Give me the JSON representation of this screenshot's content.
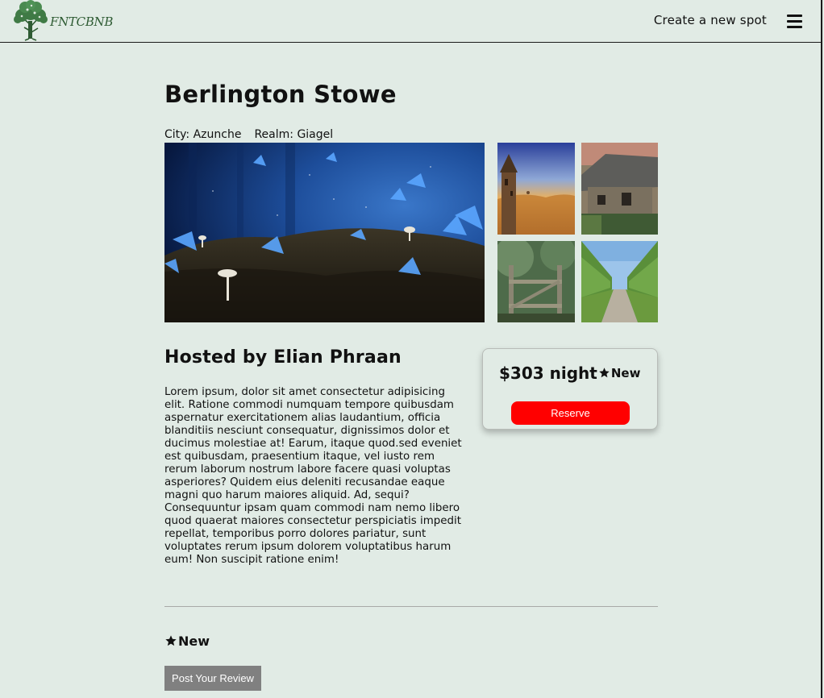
{
  "header": {
    "logo_text": "FNTCBNB",
    "create_link": "Create a new spot",
    "menu_icon": "hamburger-menu-icon"
  },
  "spot": {
    "name": "Berlington Stowe",
    "city_label": "City: Azunche",
    "realm_label": "Realm: Giagel",
    "host_heading": "Hosted by Elian Phraan",
    "description": "Lorem ipsum, dolor sit amet consectetur adipisicing elit. Ratione commodi numquam tempore quibusdam aspernatur exercitationem alias laudantium, officia blanditiis nesciunt consequatur, dignissimos dolor et ducimus molestiae at! Earum, itaque quod.sed eveniet est quibusdam, praesentium itaque, vel iusto rem rerum laborum nostrum labore facere quasi voluptas asperiores? Quidem eius deleniti recusandae eaque magni quo harum maiores aliquid. Ad, sequi?Consequuntur ipsam quam commodi nam nemo libero quod quaerat maiores consectetur perspiciatis impedit repellat, temporibus porro dolores pariatur, sunt voluptates rerum ipsum dolorem voluptatibus harum eum! Non suscipit ratione enim!"
  },
  "booking": {
    "price": "$303 night",
    "rating": "New",
    "reserve_label": "Reserve"
  },
  "reviews": {
    "rating": "New",
    "post_label": "Post Your Review"
  },
  "colors": {
    "background": "#e1ebe5",
    "reserve_button": "#ff0000",
    "post_review_button": "#808080",
    "logo": "#2e5b33"
  }
}
